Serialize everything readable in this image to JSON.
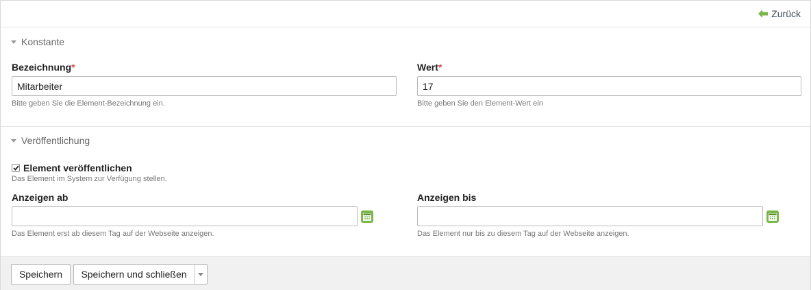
{
  "header": {
    "back_label": "Zurück"
  },
  "sections": {
    "konstante": {
      "title": "Konstante",
      "bezeichnung": {
        "label": "Bezeichnung",
        "required_mark": "*",
        "value": "Mitarbeiter",
        "help": "Bitte geben Sie die Element-Bezeichnung ein."
      },
      "wert": {
        "label": "Wert",
        "required_mark": "*",
        "value": "17",
        "help": "Bitte geben Sie den Element-Wert ein"
      }
    },
    "veroeffentlichung": {
      "title": "Veröffentlichung",
      "publish": {
        "label": "Element veröffentlichen",
        "checked": true,
        "help": "Das Element im System zur Verfügung stellen."
      },
      "anzeigen_ab": {
        "label": "Anzeigen ab",
        "value": "",
        "help": "Das Element erst ab diesem Tag auf der Webseite anzeigen."
      },
      "anzeigen_bis": {
        "label": "Anzeigen bis",
        "value": "",
        "help": "Das Element nur bis zu diesem Tag auf der Webseite anzeigen."
      }
    }
  },
  "footer": {
    "save_label": "Speichern",
    "save_close_label": "Speichern und schließen"
  },
  "colors": {
    "accent_green": "#7ab648",
    "required_red": "#d9534f"
  },
  "icons": {
    "back": "arrow-left-icon",
    "calendar": "calendar-icon",
    "caret": "caret-down-icon"
  }
}
